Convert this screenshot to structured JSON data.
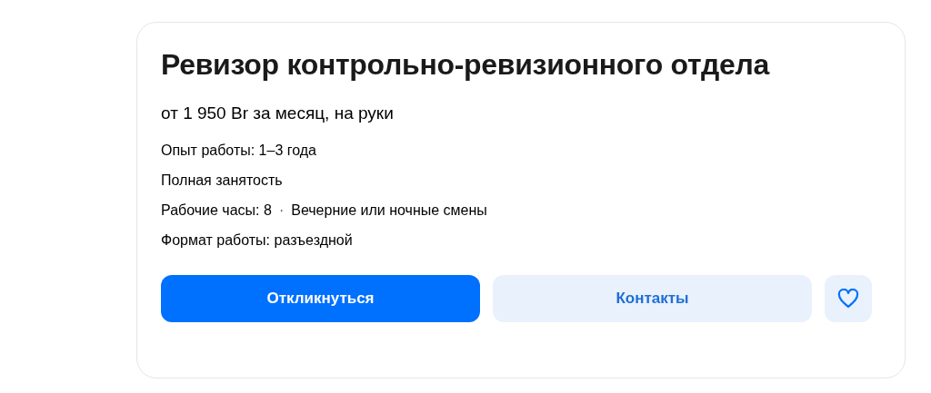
{
  "vacancy": {
    "title": "Ревизор контрольно-ревизионного отдела",
    "salary": "от 1 950 Br за месяц, на руки",
    "details": [
      {
        "parts": [
          "Опыт работы: 1–3 года"
        ]
      },
      {
        "parts": [
          "Полная занятость"
        ]
      },
      {
        "parts": [
          "Рабочие часы: 8",
          "Вечерние или ночные смены"
        ],
        "separator": "·"
      },
      {
        "parts": [
          "Формат работы: разъездной"
        ]
      }
    ],
    "buttons": [
      {
        "kind": "primary",
        "label": "Откликнуться"
      },
      {
        "kind": "secondary",
        "label": "Контакты"
      },
      {
        "kind": "favorite"
      }
    ]
  }
}
